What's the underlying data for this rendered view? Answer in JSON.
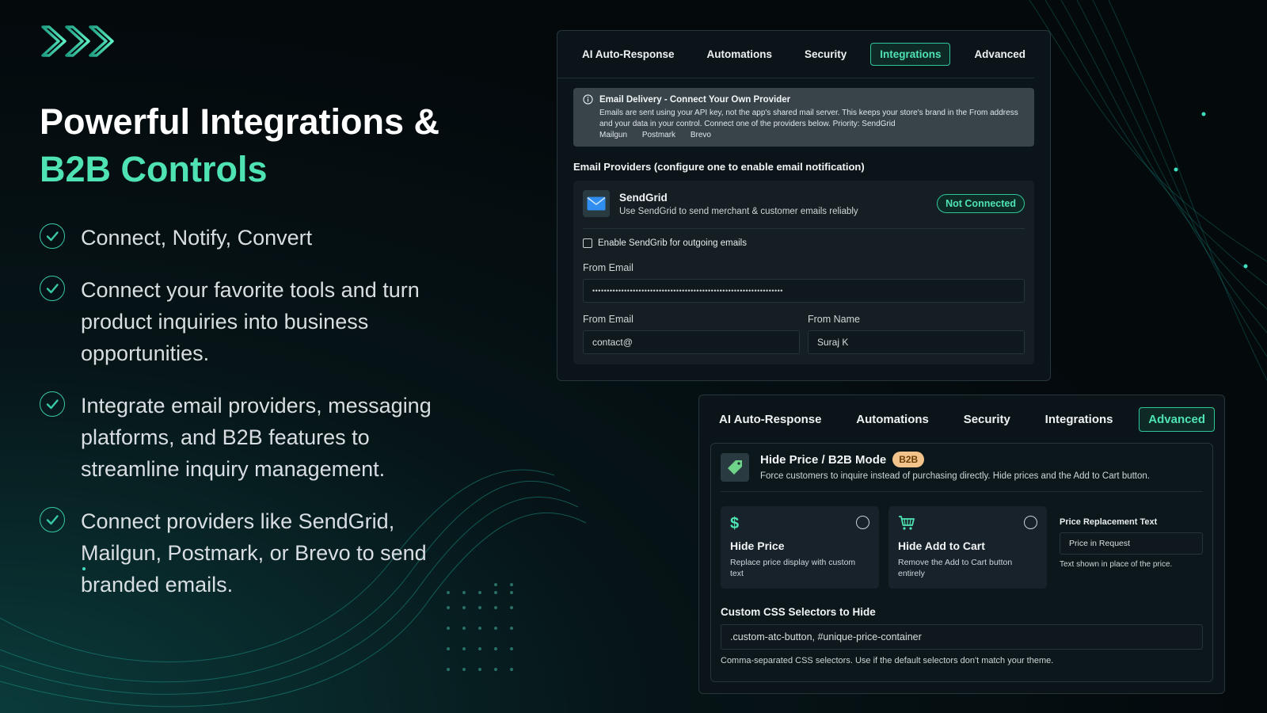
{
  "hero": {
    "title_line1": "Powerful Integrations &",
    "title_line2": "B2B Controls"
  },
  "features": [
    "Connect, Notify, Convert",
    "Connect your favorite tools and turn product inquiries into business opportunities.",
    "Integrate email providers, messaging platforms, and B2B features to streamline inquiry management.",
    "Connect providers like SendGrid, Mailgun, Postmark, or Brevo to send branded emails."
  ],
  "panel1": {
    "tabs": [
      "AI Auto-Response",
      "Automations",
      "Security",
      "Integrations",
      "Advanced"
    ],
    "active_tab": "Integrations",
    "info": {
      "title": "Email Delivery - Connect Your Own Provider",
      "body": "Emails are sent using your API key, not the app's shared mail server. This keeps your store's brand in the From address and your data in your control. Connect one of the providers below. Priority: SendGrid",
      "providers": [
        "Mailgun",
        "Postmark",
        "Brevo"
      ]
    },
    "section_label": "Email Providers (configure one to enable email notification)",
    "provider": {
      "name": "SendGrid",
      "description": "Use SendGrid to send merchant & customer emails reliably",
      "status": "Not Connected",
      "checkbox_label": "Enable SendGrib for outgoing emails",
      "api_label": "From Email",
      "api_value": "••••••••••••••••••••••••••••••••••••••••••••••••••••••••••••••••••",
      "from_email_label": "From Email",
      "from_email_value": "contact@",
      "from_name_label": "From Name",
      "from_name_value": "Suraj K"
    }
  },
  "panel2": {
    "tabs": [
      "AI Auto-Response",
      "Automations",
      "Security",
      "Integrations",
      "Advanced"
    ],
    "active_tab": "Advanced",
    "b2b": {
      "title": "Hide Price / B2B Mode",
      "badge": "B2B",
      "description": "Force customers to inquire instead of purchasing directly. Hide prices and the Add to Cart button.",
      "option1": {
        "icon": "$",
        "title": "Hide Price",
        "description": "Replace price display with custom text"
      },
      "option2": {
        "icon": "cart-icon",
        "title": "Hide Add to Cart",
        "description": "Remove the Add to Cart button entirely"
      },
      "replacement_label": "Price Replacement Text",
      "replacement_value": "Price in Request",
      "replacement_help": "Text shown in place of the price.",
      "css_label": "Custom CSS Selectors to Hide",
      "css_value": ".custom-atc-button, #unique-price-container",
      "css_help": "Comma-separated CSS selectors. Use if the default selectors don't match your theme."
    }
  },
  "colors": {
    "accent": "#4fe3b3",
    "badge_b2b": "#f2c38a",
    "background": "#04090c"
  }
}
